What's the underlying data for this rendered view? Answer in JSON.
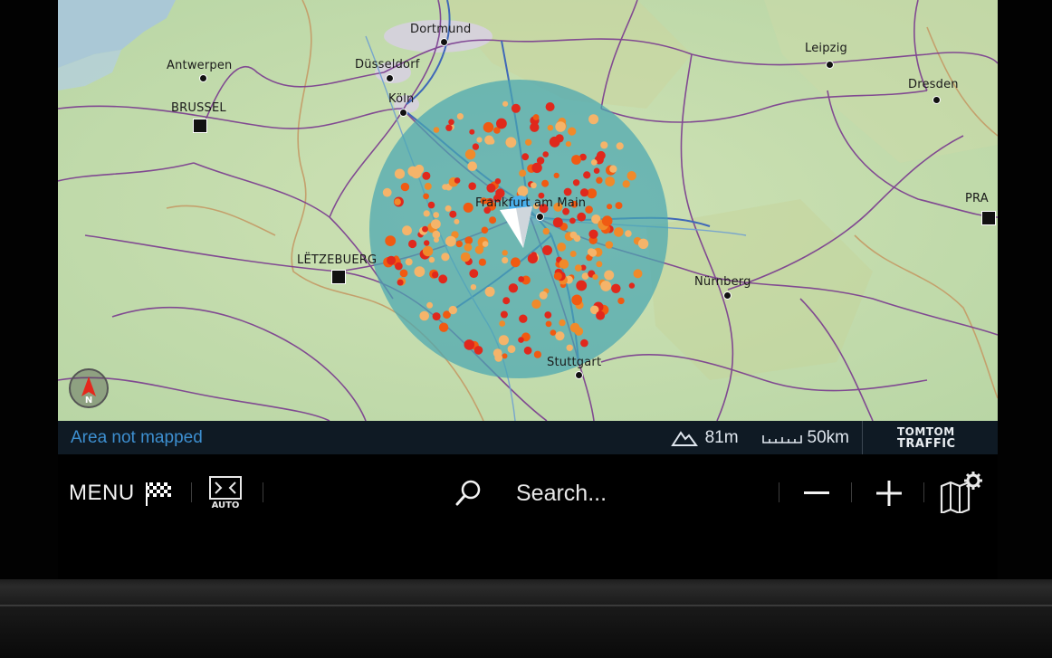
{
  "map": {
    "cities": [
      {
        "id": "dortmund",
        "label": "Dortmund",
        "marker": "dot"
      },
      {
        "id": "antwerpen",
        "label": "Antwerpen",
        "marker": "dot"
      },
      {
        "id": "dusseldorf",
        "label": "Düsseldorf",
        "marker": "dot"
      },
      {
        "id": "koln",
        "label": "Köln",
        "marker": "dot"
      },
      {
        "id": "brussel",
        "label": "BRUSSEL",
        "marker": "square"
      },
      {
        "id": "frankfurt",
        "label": "Frankfurt am Main",
        "marker": "dot"
      },
      {
        "id": "letzebuerg",
        "label": "LËTZEBUERG",
        "marker": "square"
      },
      {
        "id": "nurnberg",
        "label": "Nürnberg",
        "marker": "dot"
      },
      {
        "id": "stuttgart",
        "label": "Stuttgart",
        "marker": "dot"
      },
      {
        "id": "leipzig",
        "label": "Leipzig",
        "marker": "dot"
      },
      {
        "id": "dresden",
        "label": "Dresden",
        "marker": "dot"
      },
      {
        "id": "praha",
        "label": "PRA",
        "marker": "square"
      }
    ],
    "compass": {
      "label": "N",
      "icon": "compass-north-icon"
    },
    "range_circle_color": "#4aa6b2",
    "poi_colors": [
      "#e0281c",
      "#f05a12",
      "#f08a2a",
      "#f5b46a"
    ]
  },
  "status_bar": {
    "area_text": "Area not mapped",
    "altitude": "81m",
    "scale": "50km",
    "provider_line1": "TOMTOM",
    "provider_line2": "TRAFFIC"
  },
  "bottom_bar": {
    "menu_label": "MENU",
    "destination_icon": "checkered-flag-icon",
    "view_mode_label": "AUTO",
    "search_placeholder": "Search...",
    "zoom_out_label": "−",
    "zoom_in_label": "+",
    "map_settings_icon": "map-settings-icon"
  }
}
